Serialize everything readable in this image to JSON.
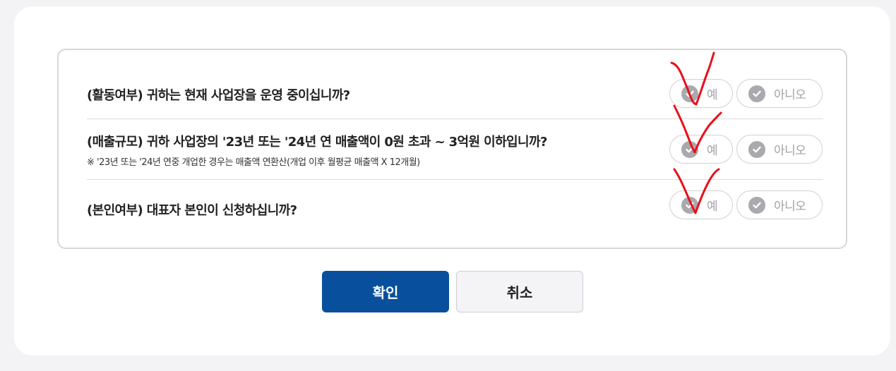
{
  "questions": [
    {
      "text": "(활동여부) 귀하는 현재 사업장을 운영 중이십니까?",
      "note": "",
      "yes_label": "예",
      "no_label": "아니오"
    },
    {
      "text": "(매출규모) 귀하 사업장의 '23년 또는 '24년 연 매출액이 0원 초과 ~ 3억원 이하입니까?",
      "note": "※ '23년 또는 '24년 연중 개업한 경우는 매출액 연환산(개업 이후 월평균 매출액 X 12개월)",
      "yes_label": "예",
      "no_label": "아니오"
    },
    {
      "text": "(본인여부) 대표자 본인이 신청하십니까?",
      "note": "",
      "yes_label": "예",
      "no_label": "아니오"
    }
  ],
  "buttons": {
    "confirm_label": "확인",
    "cancel_label": "취소"
  },
  "colors": {
    "primary": "#08509d",
    "check_inactive": "#a9a9ae",
    "annotation": "#e8101b"
  },
  "icons": {
    "option_check": "check-circle-icon"
  }
}
